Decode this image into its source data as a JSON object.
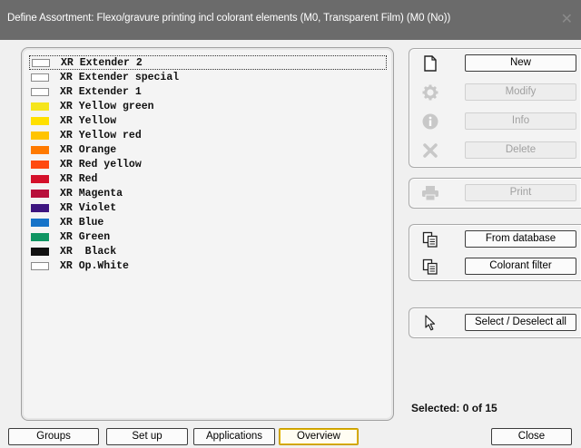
{
  "window": {
    "title": "Define Assortment: Flexo/gravure printing incl colorant elements (M0, Transparent Film) (M0 (No))",
    "close_glyph": "✕"
  },
  "colorants": [
    {
      "label": "XR Extender 2",
      "color": "#ffffff"
    },
    {
      "label": "XR Extender special",
      "color": "#ffffff"
    },
    {
      "label": "XR Extender 1",
      "color": "#ffffff"
    },
    {
      "label": "XR Yellow green",
      "color": "#f5e51c"
    },
    {
      "label": "XR Yellow",
      "color": "#ffe000"
    },
    {
      "label": "XR Yellow red",
      "color": "#ffc400"
    },
    {
      "label": "XR Orange",
      "color": "#ff7a00"
    },
    {
      "label": "XR Red yellow",
      "color": "#ff4a10"
    },
    {
      "label": "XR Red",
      "color": "#d4102a"
    },
    {
      "label": "XR Magenta",
      "color": "#b8103c"
    },
    {
      "label": "XR Violet",
      "color": "#3d157f"
    },
    {
      "label": "XR Blue",
      "color": "#1673c8"
    },
    {
      "label": "XR Green",
      "color": "#0f9562"
    },
    {
      "label": "XR  Black",
      "color": "#111111"
    },
    {
      "label": "XR Op.White",
      "color": "#ffffff"
    }
  ],
  "actions": {
    "new": "New",
    "modify": "Modify",
    "info": "Info",
    "delete": "Delete",
    "print": "Print",
    "from_database": "From database",
    "colorant_filter": "Colorant filter",
    "select_all": "Select / Deselect all"
  },
  "status": {
    "selected": "Selected: 0 of 15"
  },
  "tabs": {
    "groups": "Groups",
    "setup": "Set up",
    "applications": "Applications",
    "overview": "Overview"
  },
  "footer": {
    "close": "Close"
  },
  "icons": {
    "new": "new-document-icon",
    "modify": "gear-icon",
    "info": "info-icon",
    "delete": "delete-x-icon",
    "print": "printer-icon",
    "from_database": "copy-pages-icon",
    "colorant_filter": "copy-pages-icon",
    "select_all": "cursor-arrow-icon"
  }
}
